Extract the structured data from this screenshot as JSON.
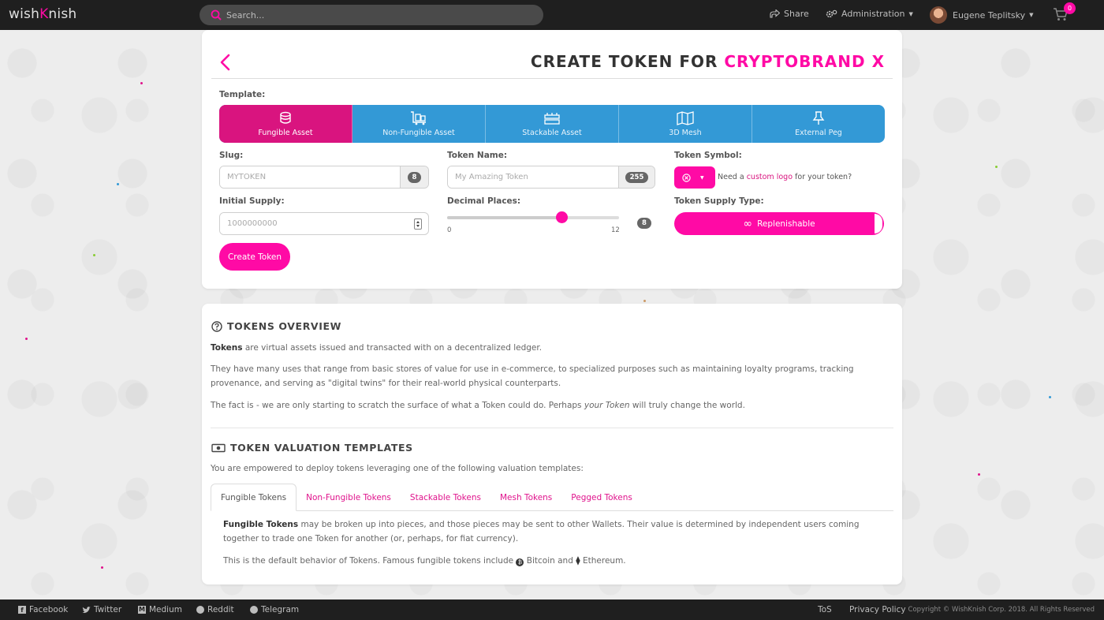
{
  "topbar": {
    "logo_left": "wish",
    "logo_x": "K",
    "logo_right": "nish",
    "search_placeholder": "Search...",
    "share_label": "Share",
    "admin_label": "Administration",
    "user_name": "Eugene Teplitsky",
    "cart_count": "0"
  },
  "form": {
    "title_prefix": "CREATE TOKEN FOR",
    "title_brand": "CRYPTOBRAND X",
    "template_label": "Template:",
    "templates": [
      {
        "label": "Fungible Asset",
        "icon": "coins-icon"
      },
      {
        "label": "Non-Fungible Asset",
        "icon": "luggage-cart-icon"
      },
      {
        "label": "Stackable Asset",
        "icon": "stack-icon"
      },
      {
        "label": "3D Mesh",
        "icon": "map-icon"
      },
      {
        "label": "External Peg",
        "icon": "thumbtack-icon"
      }
    ],
    "active_template": "Fungible Asset",
    "slug_label": "Slug:",
    "slug_placeholder": "MYTOKEN",
    "slug_max": "8",
    "token_name_label": "Token Name:",
    "token_name_placeholder": "My Amazing Token",
    "token_name_max": "255",
    "token_symbol_label": "Token Symbol:",
    "symbol_note_before": "Need a",
    "symbol_note_link": "custom logo",
    "symbol_note_after": "for your token?",
    "initial_supply_label": "Initial Supply:",
    "initial_supply_placeholder": "1000000000",
    "decimal_places_label": "Decimal Places:",
    "decimal_min": "0",
    "decimal_max": "12",
    "decimal_value": "8",
    "supply_type_label": "Token Supply Type:",
    "supply_type_value": "Replenishable",
    "create_button": "Create Token",
    "accent_color": "#ff0aa5",
    "template_color": "#3399d6"
  },
  "overview": {
    "heading": "TOKENS OVERVIEW",
    "p1_bold": "Tokens",
    "p1_rest": " are virtual assets issued and transacted with on a decentralized ledger.",
    "p2": "They have many uses that range from basic stores of value for use in e-commerce, to specialized purposes such as maintaining loyalty programs, tracking provenance, and serving as \"digital twins\" for their real-world physical counterparts.",
    "p3_before": "The fact is - we are only starting to scratch the surface of what a Token could do. Perhaps ",
    "p3_em": "your Token",
    "p3_after": " will truly change the world.",
    "valuation_heading": "TOKEN VALUATION TEMPLATES",
    "valuation_intro": "You are empowered to deploy tokens leveraging one of the following valuation templates:",
    "tabs": [
      "Fungible Tokens",
      "Non-Fungible Tokens",
      "Stackable Tokens",
      "Mesh Tokens",
      "Pegged Tokens"
    ],
    "active_tab": "Fungible Tokens",
    "tab_p1_bold": "Fungible Tokens",
    "tab_p1_rest": " may be broken up into pieces, and those pieces may be sent to other Wallets. Their value is determined by independent users coming together to trade one Token for another (or, perhaps, for fiat currency).",
    "tab_p2_before": "This is the default behavior of Tokens. Famous fungible tokens include ",
    "tab_p2_btc": "Bitcoin",
    "tab_p2_mid": " and ",
    "tab_p2_eth": "Ethereum."
  },
  "footer": {
    "links": [
      "Facebook",
      "Twitter",
      "Medium",
      "Reddit",
      "Telegram"
    ],
    "tos": "ToS",
    "privacy": "Privacy Policy",
    "copyright": "Copyright © WishKnish Corp. 2018. All Rights Reserved"
  }
}
